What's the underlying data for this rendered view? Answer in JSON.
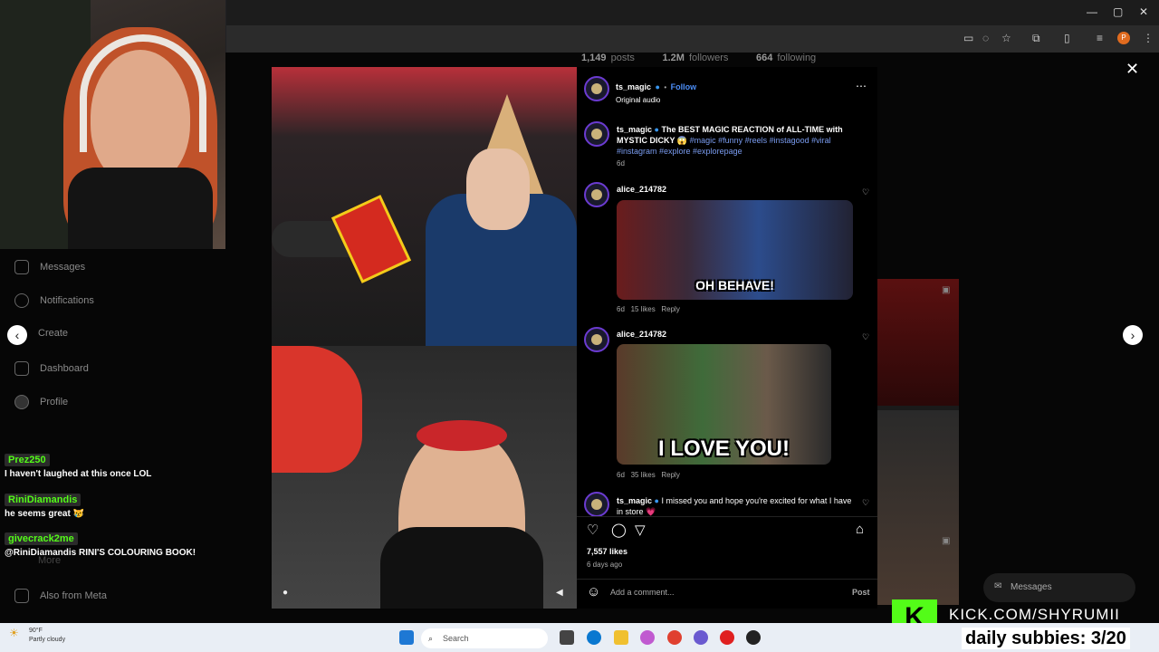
{
  "profile_stats": {
    "posts": "1,149",
    "posts_label": "posts",
    "followers": "1.2M",
    "followers_label": "followers",
    "following": "664",
    "following_label": "following"
  },
  "sidebar": {
    "items": [
      {
        "label": "Messages",
        "icon": "messages-icon"
      },
      {
        "label": "Notifications",
        "icon": "heart-icon"
      },
      {
        "label": "Create",
        "icon": "plus-icon"
      },
      {
        "label": "Dashboard",
        "icon": "dashboard-icon"
      },
      {
        "label": "Profile",
        "icon": "avatar-icon"
      },
      {
        "label": "More",
        "icon": "menu-icon"
      },
      {
        "label": "Also from Meta",
        "icon": "meta-icon"
      }
    ]
  },
  "post": {
    "author": "ts_magic",
    "follow_label": "Follow",
    "audio": "Original audio",
    "caption_user": "ts_magic",
    "caption_text": "The BEST MAGIC REACTION of ALL-TIME with MYSTIC DICKY 😱",
    "caption_tags": "#magic #funny #reels #instagood #viral #instagram #explore #explorepage",
    "caption_age": "6d",
    "likes": "7,557 likes",
    "date": "6 days ago",
    "comment_placeholder": "Add a comment...",
    "post_label": "Post"
  },
  "comments": [
    {
      "user": "alice_214782",
      "gif_text": "OH BEHAVE!",
      "age": "6d",
      "likes": "15 likes",
      "reply": "Reply"
    },
    {
      "user": "alice_214782",
      "gif_text": "I LOVE YOU!",
      "age": "6d",
      "likes": "35 likes",
      "reply": "Reply"
    },
    {
      "user": "ts_magic",
      "text": "I missed you and hope you're excited for what I have in store 💗"
    }
  ],
  "chat": [
    {
      "user": "Prez250",
      "message": "I haven't laughed at this once LOL"
    },
    {
      "user": "RiniDiamandis",
      "message": "he seems great 😿"
    },
    {
      "user": "givecrack2me",
      "message": "@RiniDiamandis RINI'S COLOURING BOOK!"
    }
  ],
  "overlay": {
    "kick_url": "KICK.COM/SHYRUMII",
    "subs": "daily subbies: 3/20",
    "kick_letter": "K"
  },
  "messages_widget": {
    "label": "Messages"
  },
  "taskbar": {
    "temp": "90°F",
    "weather": "Partly cloudy",
    "search": "Search"
  },
  "colors": {
    "accent": "#4c8ef7",
    "kick_green": "#53fc18",
    "verified": "#3897f0"
  }
}
